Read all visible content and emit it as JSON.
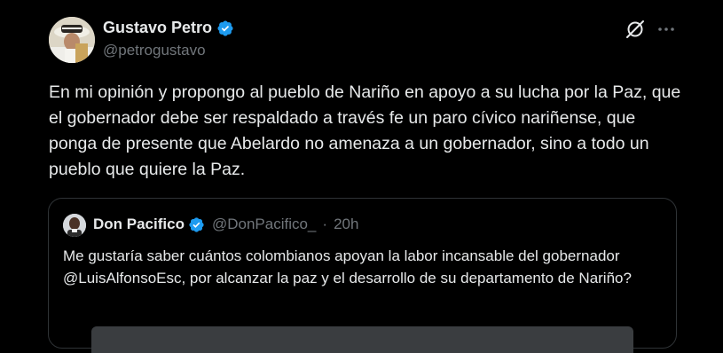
{
  "author": {
    "name": "Gustavo Petro",
    "handle": "@petrogustavo",
    "verified": true,
    "verified_color": "#1d9bf0"
  },
  "tweet": {
    "text": "En mi opinión y propongo al pueblo de Nariño en apoyo a su lucha por la Paz, que el gobernador debe ser respaldado a través fe un paro cívico nariñense, que ponga de presente que Abelardo no amenaza a un gobernador, sino a todo un pueblo que quiere la Paz."
  },
  "actions": {
    "grok_icon": "grok-icon",
    "more_icon": "more-options-icon"
  },
  "quoted": {
    "name": "Don Pacifico",
    "handle": "@DonPacifico_",
    "separator": "·",
    "time": "20h",
    "verified": true,
    "text": "Me gustaría saber cuántos colombianos apoyan la labor incansable del gobernador @LuisAlfonsoEsc, por alcanzar la paz y el desarrollo de su departamento de Nariño?"
  },
  "colors": {
    "background": "#000000",
    "text_primary": "#e7e9ea",
    "text_secondary": "#71767b",
    "border": "#2f3336",
    "accent": "#1d9bf0"
  }
}
